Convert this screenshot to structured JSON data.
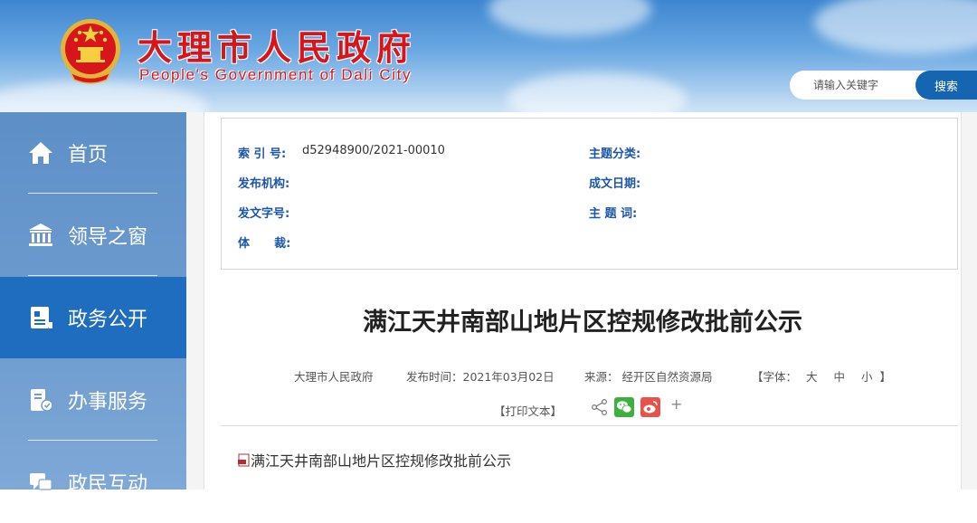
{
  "header": {
    "title": "大理市人民政府",
    "subtitle": "People's Government of Dali City",
    "emblem_icon": "national-emblem-icon",
    "colors": {
      "title": "#d7161b",
      "header_bg": "#5a9ad9"
    }
  },
  "search": {
    "placeholder": "请输入关键字",
    "button_label": "搜索"
  },
  "sidebar": {
    "items": [
      {
        "label": "首页",
        "icon": "home-icon",
        "active": false
      },
      {
        "label": "领导之窗",
        "icon": "building-icon",
        "active": false
      },
      {
        "label": "政务公开",
        "icon": "document-icon",
        "active": true
      },
      {
        "label": "办事服务",
        "icon": "service-icon",
        "active": false
      },
      {
        "label": "政民互动",
        "icon": "chat-icon",
        "active": false
      }
    ]
  },
  "meta": {
    "index_label": "索 引 号:",
    "index_value": "d52948900/2021-00010",
    "category_label": "主题分类:",
    "category_value": "",
    "publisher_label": "发布机构:",
    "publisher_value": "",
    "date_label": "成文日期:",
    "date_value": "",
    "doc_no_label": "发文字号:",
    "doc_no_value": "",
    "subject_label": "主 题 词:",
    "subject_value": "",
    "genre_label": "体      裁:",
    "genre_value": ""
  },
  "article": {
    "title": "满江天井南部山地片区控规修改批前公示",
    "source_org": "大理市人民政府",
    "publish_time": "发布时间：2021年03月02日",
    "origin": "来源： 经开区自然资源局",
    "font_size_prefix": "【字体：",
    "font_large": "大",
    "font_medium": "中",
    "font_small": "小",
    "font_size_suffix": "】",
    "print_label": "【打印文本】",
    "share_plus": "+",
    "attachment_label": "满江天井南部山地片区控规修改批前公示"
  }
}
